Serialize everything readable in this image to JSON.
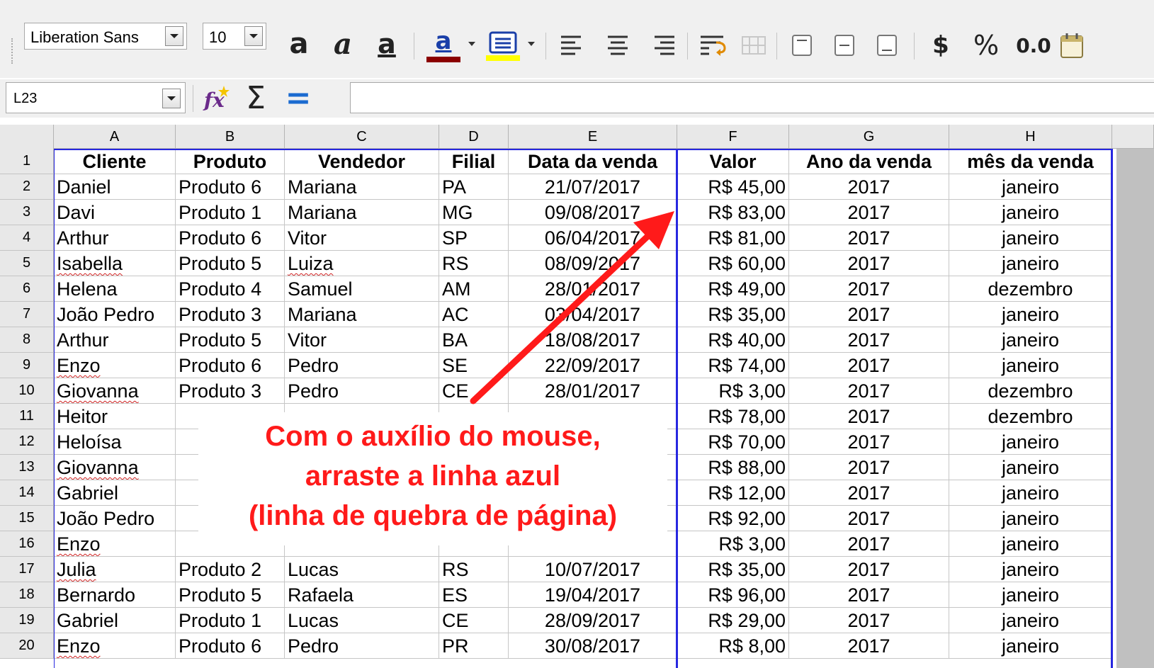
{
  "toolbar": {
    "font_name": "Liberation Sans",
    "font_size": "10",
    "bold_glyph": "a",
    "italic_glyph": "a",
    "underline_glyph": "a",
    "font_color_glyph": "a",
    "currency_label": "$",
    "percent_label": "%",
    "number_label": "0.0",
    "font_color": "#8b0000",
    "highlight_color": "#ffff00"
  },
  "formula_bar": {
    "name_box": "L23",
    "sum_glyph": "Σ",
    "equals_glyph": "="
  },
  "grid": {
    "columns": [
      "A",
      "B",
      "C",
      "D",
      "E",
      "F",
      "G",
      "H"
    ],
    "header_row": [
      "Cliente",
      "Produto",
      "Vendedor",
      "Filial",
      "Data da venda",
      "Valor",
      "Ano da venda",
      "mês da venda"
    ],
    "row_numbers": [
      "1",
      "2",
      "3",
      "4",
      "5",
      "6",
      "7",
      "8",
      "9",
      "10",
      "11",
      "12",
      "13",
      "14",
      "15",
      "16",
      "17",
      "18",
      "19",
      "20"
    ],
    "rows": [
      [
        "Daniel",
        "Produto 6",
        "Mariana",
        "PA",
        "21/07/2017",
        "R$ 45,00",
        "2017",
        "janeiro"
      ],
      [
        "Davi",
        "Produto 1",
        "Mariana",
        "MG",
        "09/08/2017",
        "R$ 83,00",
        "2017",
        "janeiro"
      ],
      [
        "Arthur",
        "Produto 6",
        "Vitor",
        "SP",
        "06/04/2017",
        "R$ 81,00",
        "2017",
        "janeiro"
      ],
      [
        "Isabella",
        "Produto 5",
        "Luiza",
        "RS",
        "08/09/2017",
        "R$ 60,00",
        "2017",
        "janeiro"
      ],
      [
        "Helena",
        "Produto 4",
        "Samuel",
        "AM",
        "28/01/2017",
        "R$ 49,00",
        "2017",
        "dezembro"
      ],
      [
        "João Pedro",
        "Produto 3",
        "Mariana",
        "AC",
        "03/04/2017",
        "R$ 35,00",
        "2017",
        "janeiro"
      ],
      [
        "Arthur",
        "Produto 5",
        "Vitor",
        "BA",
        "18/08/2017",
        "R$ 40,00",
        "2017",
        "janeiro"
      ],
      [
        "Enzo",
        "Produto 6",
        "Pedro",
        "SE",
        "22/09/2017",
        "R$ 74,00",
        "2017",
        "janeiro"
      ],
      [
        "Giovanna",
        "Produto 3",
        "Pedro",
        "CE",
        "28/01/2017",
        "R$ 3,00",
        "2017",
        "dezembro"
      ],
      [
        "Heitor",
        "",
        "",
        "",
        "",
        "R$ 78,00",
        "2017",
        "dezembro"
      ],
      [
        "Heloísa",
        "",
        "",
        "",
        "",
        "R$ 70,00",
        "2017",
        "janeiro"
      ],
      [
        "Giovanna",
        "",
        "",
        "",
        "",
        "R$ 88,00",
        "2017",
        "janeiro"
      ],
      [
        "Gabriel",
        "",
        "",
        "",
        "",
        "R$ 12,00",
        "2017",
        "janeiro"
      ],
      [
        "João Pedro",
        "",
        "",
        "",
        "",
        "R$ 92,00",
        "2017",
        "janeiro"
      ],
      [
        "Enzo",
        "",
        "",
        "",
        "",
        "R$ 3,00",
        "2017",
        "janeiro"
      ],
      [
        "Julia",
        "Produto 2",
        "Lucas",
        "RS",
        "10/07/2017",
        "R$ 35,00",
        "2017",
        "janeiro"
      ],
      [
        "Bernardo",
        "Produto 5",
        "Rafaela",
        "ES",
        "19/04/2017",
        "R$ 96,00",
        "2017",
        "janeiro"
      ],
      [
        "Gabriel",
        "Produto 1",
        "Lucas",
        "CE",
        "28/09/2017",
        "R$ 29,00",
        "2017",
        "janeiro"
      ],
      [
        "Enzo",
        "Produto 6",
        "Pedro",
        "PR",
        "30/08/2017",
        "R$ 8,00",
        "2017",
        "janeiro"
      ]
    ],
    "spell_flagged": [
      "Isabella",
      "Luiza",
      "Enzo",
      "Giovanna",
      "Julia"
    ],
    "page_break_color": "#2727e0"
  },
  "annotation": {
    "line1": "Com o auxílio do mouse,",
    "line2": "arraste a linha azul",
    "line3": "(linha de quebra de página)",
    "color": "#ff1a1a"
  }
}
